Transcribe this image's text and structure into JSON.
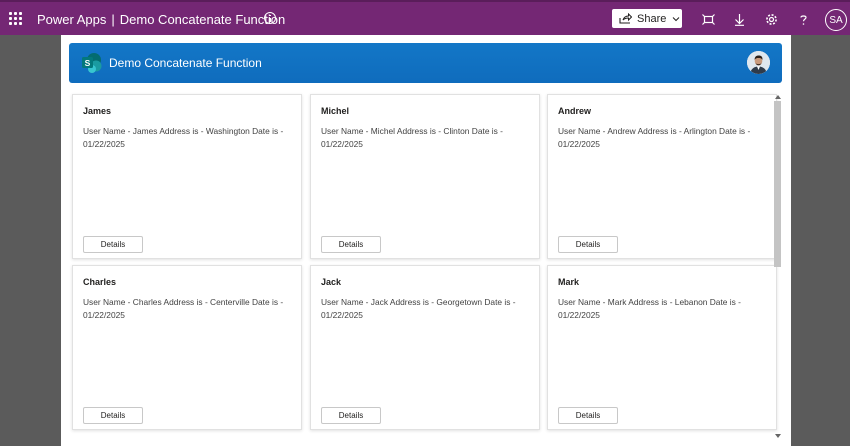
{
  "topbar": {
    "app_name": "Power Apps",
    "separator": "|",
    "doc_title": "Demo Concatenate Function",
    "share_label": "Share",
    "avatar_initials": "SA"
  },
  "app": {
    "header_title": "Demo Concatenate Function",
    "logo_letter": "S"
  },
  "cards": [
    {
      "name": "James",
      "text": "User Name - James  Address is - Washington  Date is - 01/22/2025",
      "button": "Details"
    },
    {
      "name": "Michel",
      "text": "User Name - Michel  Address is - Clinton  Date is - 01/22/2025",
      "button": "Details"
    },
    {
      "name": "Andrew",
      "text": "User Name - Andrew  Address is - Arlington  Date is - 01/22/2025",
      "button": "Details"
    },
    {
      "name": "Charles",
      "text": "User Name - Charles  Address is - Centerville  Date is - 01/22/2025",
      "button": "Details"
    },
    {
      "name": "Jack",
      "text": "User Name - Jack  Address is - Georgetown  Date is - 01/22/2025",
      "button": "Details"
    },
    {
      "name": "Mark",
      "text": "User Name - Mark  Address is - Lebanon  Date is - 01/22/2025",
      "button": "Details"
    }
  ],
  "colors": {
    "topbar": "#742774",
    "header": "#0f6cbd",
    "background": "#5b5b5b"
  },
  "icons": [
    "app-launcher-icon",
    "info-icon",
    "share-icon",
    "chevron-down-icon",
    "fit-to-screen-icon",
    "download-icon",
    "settings-icon",
    "help-icon",
    "sharepoint-logo-icon"
  ]
}
